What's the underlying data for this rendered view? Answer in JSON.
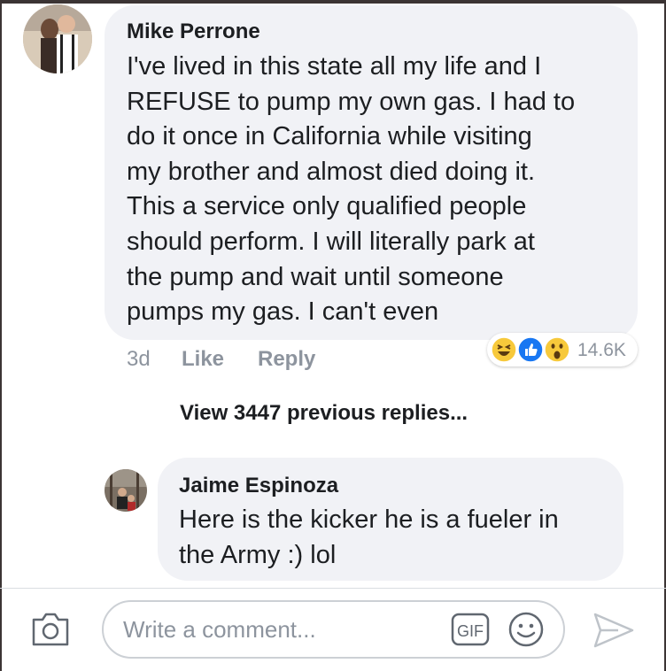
{
  "comment": {
    "author": "Mike Perrone",
    "text": "I've lived in this state all my life and I REFUSE to pump my own gas. I had to do it once in California while visiting my brother and almost died doing it. This a service only qualified people should perform. I will literally park at the pump and wait until someone pumps my gas. I can't even",
    "lines": [
      "I've lived in this state all my life and I",
      "REFUSE to pump my own gas. I had to",
      "do it once in California while visiting",
      "my brother and almost died doing it.",
      "This a service only qualified people",
      "should perform. I will literally park at",
      "the pump and wait until someone",
      "pumps my gas. I can't even"
    ],
    "age": "3d",
    "like_label": "Like",
    "reply_label": "Reply",
    "reactions": {
      "count": "14.6K",
      "types": [
        "haha-icon",
        "like-icon",
        "wow-icon"
      ],
      "colors": {
        "haha": "#f7c93b",
        "like": "#1877f2",
        "wow": "#f7c93b"
      }
    }
  },
  "view_previous": "View 3447 previous replies...",
  "reply": {
    "author": "Jaime Espinoza",
    "lines": [
      "Here is the kicker he is a fueler in",
      "the Army :) lol"
    ]
  },
  "composer": {
    "placeholder": "Write a comment...",
    "gif_label": "GIF",
    "icons": [
      "camera-icon",
      "gif-icon",
      "emoji-icon",
      "send-icon"
    ]
  },
  "colors": {
    "bubble": "#f1f2f6",
    "meta_text": "#8d949e",
    "primary_text": "#1c1e21"
  }
}
